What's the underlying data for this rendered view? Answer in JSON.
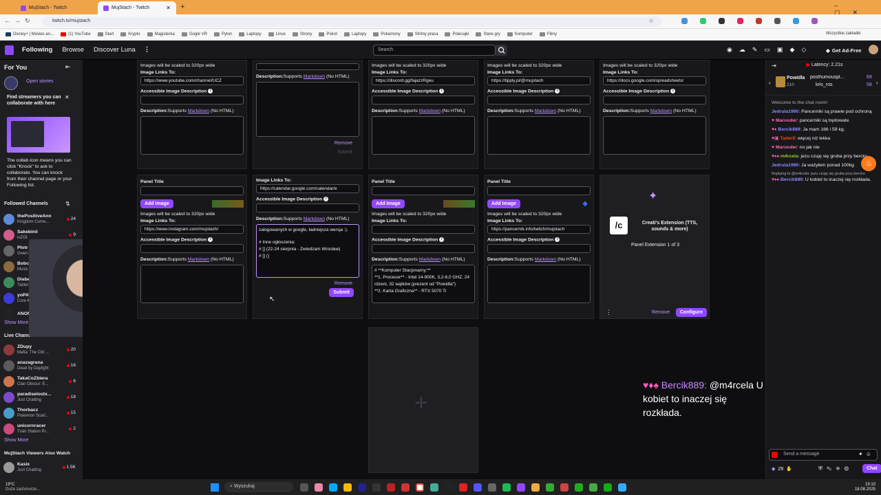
{
  "browser": {
    "tabs": [
      {
        "label": "MujStach - Twitch",
        "active": false
      },
      {
        "label": "MujStach - Twitch",
        "active": true
      }
    ],
    "url": "twitch.tv/mujstach",
    "bookmarks": [
      "Disney+ | Movies an...",
      "(1) YouTube",
      "Start",
      "Krypto",
      "Magisterka",
      "Gogle VR",
      "Pyton",
      "Laptopy",
      "Linux",
      "Strony",
      "Poirot",
      "Laptopy",
      "Pokemony",
      "Strimy praca",
      "Polecajki",
      "Stare gry",
      "Komputer",
      "Filmy"
    ],
    "all_bookmarks": "Wszystkie zakładki"
  },
  "topnav": {
    "following": "Following",
    "browse": "Browse",
    "discover": "Discover Luna",
    "search_placeholder": "Search",
    "adfree": "Get Ad-Free"
  },
  "sidebar": {
    "for_you": "For You",
    "open_stories": "Open stories",
    "collab_title": "Find streamers you can collaborate with here",
    "collab_text": "The collab icon means you can click \"Knock\" to ask to collaborate. You can knock from their channel page or your Following list.",
    "followed_header": "Followed Channels",
    "followed": [
      {
        "name": "thePositiveAnn",
        "game": "Kingdom Come...",
        "viewers": "24"
      },
      {
        "name": "Sakebinii",
        "game": "inZOI",
        "viewers": "9"
      },
      {
        "name": "Plotr",
        "game": "Gwen",
        "viewers": ""
      },
      {
        "name": "Bobcz",
        "game": "Music",
        "viewers": ""
      },
      {
        "name": "Diabel",
        "game": "Tablet",
        "viewers": ""
      },
      {
        "name": "yoPAV",
        "game": "Core K",
        "viewers": ""
      },
      {
        "name": "ANON",
        "game": "",
        "viewers": ""
      }
    ],
    "show_more": "Show More",
    "live_header": "Live Channels",
    "live": [
      {
        "name": "ZDupy",
        "game": "Mafia: The Old ...",
        "viewers": "20"
      },
      {
        "name": "anazagrana",
        "game": "Dead by Daylight",
        "viewers": "16"
      },
      {
        "name": "TakaCoZbiera",
        "game": "Clair Obscur: E...",
        "viewers": "6"
      },
      {
        "name": "paradiselostx...",
        "game": "Just Chatting",
        "viewers": "18"
      },
      {
        "name": "Thorbacz",
        "game": "Pokémon Scarl...",
        "viewers": "15"
      },
      {
        "name": "unicornracer",
        "game": "Train Station Pr...",
        "viewers": "2"
      }
    ],
    "show_more2": "Show More",
    "also_watch_header": "MujStach Viewers Also Watch",
    "also_watch": [
      {
        "name": "Kasix",
        "game": "Just Chatting",
        "viewers": "1.5K"
      }
    ]
  },
  "panels": {
    "scaled_note": "Images will be scaled to 320px wide",
    "image_links_to": "Image Links To:",
    "accessible_desc": "Accessible Image Description",
    "description": "Description:",
    "supports": "Supports",
    "markdown": "Markdown",
    "no_html": "(No HTML)",
    "panel_title": "Panel Title",
    "add_image": "Add Image",
    "remove": "Remove",
    "submit": "Submit",
    "row1_links": [
      "https://www.youtube.com/channel/UCZ",
      "",
      "https://discord.gg/fajazzRgeu",
      "https://tipply.pl/@mujstach",
      "https://docs.google.com/spreadsheets/"
    ],
    "row2_links": [
      "https://www.instagram.com/mujstach/",
      "https://calendar.google.com/calendar/e",
      "",
      "https://pancernik.info/twitch/mujstach"
    ],
    "textarea_text": [
      "zalogowanych w google, ładniejsza wersja :).",
      "",
      "# Inne ogłoszenia:",
      "# [] (22-24 sierpnia - Zwiedzam Wrocław)",
      "# [] ()"
    ],
    "pc_text": [
      "# **Komputer Stacjonarny:**",
      "**1. Procesor** - Intel 14-900K, 3,2-6,0 GHZ, 24 rdzeni, 32 wątków (prezent od \"Powidła\")",
      "**2. Karta Graficzna** - RTX 5070 Ti"
    ],
    "ext_name": "Creati's Extension (TTS, sounds & more)",
    "ext_count": "Panel Extension 1 of 3",
    "configure": "Configure"
  },
  "chat": {
    "latency": "Latency: 2.21s",
    "viewer_count1": "69",
    "viewer_count2": "58",
    "top_name1": "posthumouspl...",
    "top_name2": "kris_ros",
    "top_label": "Powidla",
    "top_count": "210",
    "welcome": "Welcome to the chat room!",
    "messages": [
      {
        "user": "Jedrula1990",
        "color": "#8a8aff",
        "text": "Pancerniki są prawie pod ochroną"
      },
      {
        "user": "Marooder",
        "color": "#ff69b4",
        "text": "pancerniki są trędowate"
      },
      {
        "user": "Bercik889",
        "color": "#8a8aff",
        "text": "Ja mam 166 i 59 kg."
      },
      {
        "user": "Tader0",
        "color": "#ff4500",
        "text": "więcej niż lekka"
      },
      {
        "user": "Marooder",
        "color": "#ff69b4",
        "text": "no jak nie"
      },
      {
        "user": "m4rcela",
        "color": "#9acd32",
        "text": "jezu czuję się gruba przy bercku"
      },
      {
        "user": "Jedrula1990",
        "color": "#8a8aff",
        "text": "Ja ważyłem ponad 100kg"
      }
    ],
    "reply_note": "Replying to @m4rcela: jezu czuję się gruba przy bercku",
    "reply_user": "Bercik889",
    "reply_text": "U kobiet to inaczej się rozkłada.",
    "send_placeholder": "Send a message",
    "points": "29",
    "chat_button": "Chat"
  },
  "overlay": {
    "user": "Bercik889:",
    "text": "@m4rcela U kobiet to inaczej się rozkłada."
  },
  "taskbar": {
    "weather": "19°C",
    "weather_desc": "Duże zachmurze...",
    "search": "Wyszukaj",
    "time": "19:10",
    "date": "18.08.2025"
  }
}
